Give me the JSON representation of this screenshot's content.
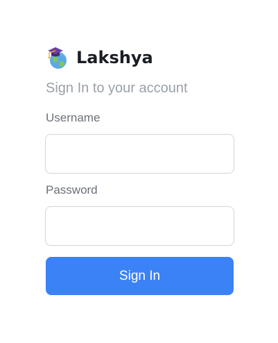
{
  "app": {
    "name": "Lakshya",
    "logo_icon": "graduation-globe-icon"
  },
  "form": {
    "subtitle": "Sign In to your account",
    "username_label": "Username",
    "username_value": "",
    "password_label": "Password",
    "password_value": "",
    "submit_label": "Sign In"
  },
  "colors": {
    "accent": "#3b82f6",
    "title_text": "#1a1d24",
    "subtitle_text": "#9aa0a8",
    "label_text": "#6b7079",
    "input_border": "#d2d4d8"
  }
}
